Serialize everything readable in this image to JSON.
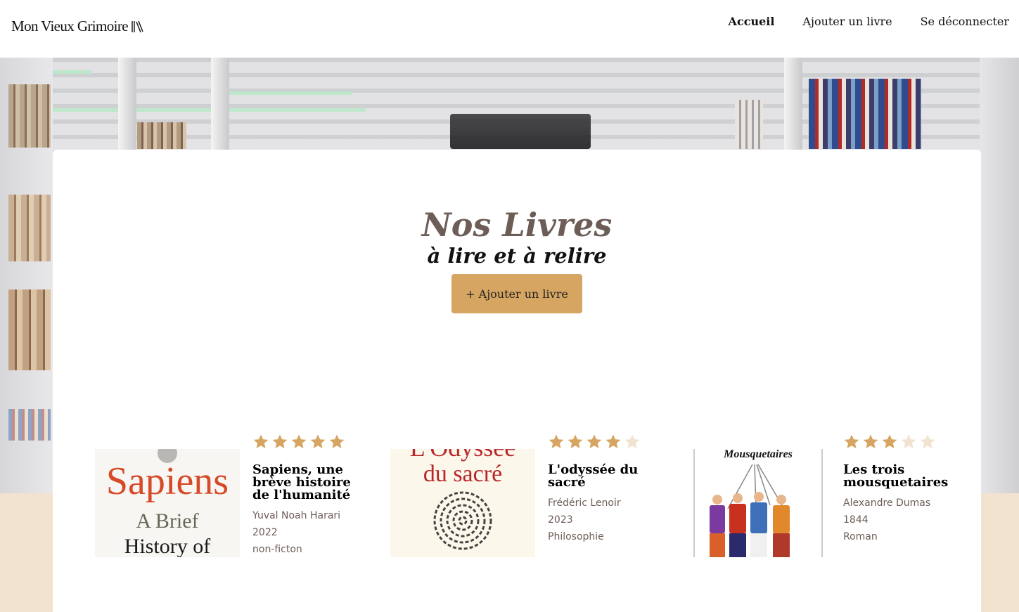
{
  "header": {
    "logo_text": "Mon Vieux Grimoire",
    "nav": {
      "home": "Accueil",
      "add_book": "Ajouter un livre",
      "logout": "Se déconnecter"
    }
  },
  "hero": {
    "title": "Nos Livres",
    "subtitle": "à lire et à relire",
    "add_button": "+ Ajouter un livre"
  },
  "colors": {
    "accent": "#d6a561",
    "star_filled": "#d6a561",
    "star_empty": "#f1e3cf",
    "muted_text": "#6d5d57",
    "beige": "#f1e3cf"
  },
  "books": [
    {
      "title": "Sapiens, une brève histoire de l'humanité",
      "author": "Yuval Noah Harari",
      "year": "2022",
      "genre": "non-ficton",
      "rating": 5,
      "cover_text": [
        "Sapiens",
        "A Brief",
        "History of"
      ]
    },
    {
      "title": "L'odyssée du sacré",
      "author": "Frédéric Lenoir",
      "year": "2023",
      "genre": "Philosophie",
      "rating": 4,
      "cover_text": [
        "L'Odyssée",
        "du sacré"
      ]
    },
    {
      "title": "Les trois mousquetaires",
      "author": "Alexandre Dumas",
      "year": "1844",
      "genre": "Roman",
      "rating": 3,
      "cover_text": [
        "Mousquetaires"
      ]
    }
  ]
}
